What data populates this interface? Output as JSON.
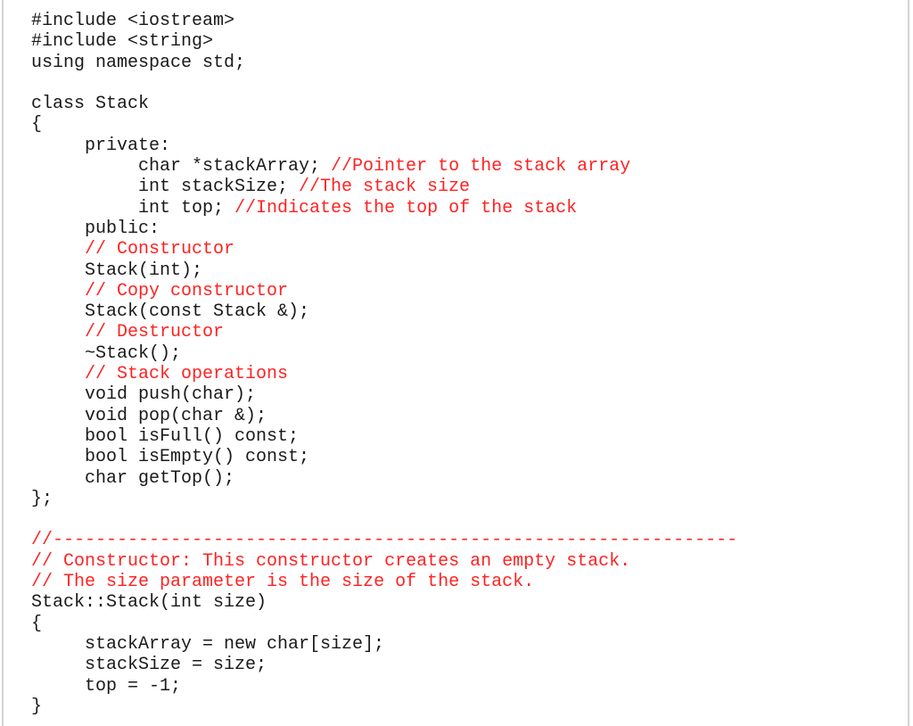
{
  "document": {
    "language": "C++",
    "colors": {
      "code_text": "#1a1a1a",
      "comment": "#ff2222",
      "border": "#d4d4d4",
      "background": "#ffffff"
    },
    "lines": [
      {
        "indent": 0,
        "code": "#include <iostream>",
        "comment": ""
      },
      {
        "indent": 0,
        "code": "#include <string>",
        "comment": ""
      },
      {
        "indent": 0,
        "code": "using namespace std;",
        "comment": ""
      },
      {
        "indent": 0,
        "code": "",
        "comment": ""
      },
      {
        "indent": 0,
        "code": "class Stack",
        "comment": ""
      },
      {
        "indent": 0,
        "code": "{",
        "comment": ""
      },
      {
        "indent": 1,
        "code": "private:",
        "comment": ""
      },
      {
        "indent": 2,
        "code": "char *stackArray; ",
        "comment": "//Pointer to the stack array"
      },
      {
        "indent": 2,
        "code": "int stackSize; ",
        "comment": "//The stack size"
      },
      {
        "indent": 2,
        "code": "int top; ",
        "comment": "//Indicates the top of the stack"
      },
      {
        "indent": 1,
        "code": "public:",
        "comment": ""
      },
      {
        "indent": 1,
        "code": "",
        "comment": "// Constructor"
      },
      {
        "indent": 1,
        "code": "Stack(int);",
        "comment": ""
      },
      {
        "indent": 1,
        "code": "",
        "comment": "// Copy constructor"
      },
      {
        "indent": 1,
        "code": "Stack(const Stack &);",
        "comment": ""
      },
      {
        "indent": 1,
        "code": "",
        "comment": "// Destructor"
      },
      {
        "indent": 1,
        "code": "~Stack();",
        "comment": ""
      },
      {
        "indent": 1,
        "code": "",
        "comment": "// Stack operations"
      },
      {
        "indent": 1,
        "code": "void push(char);",
        "comment": ""
      },
      {
        "indent": 1,
        "code": "void pop(char &);",
        "comment": ""
      },
      {
        "indent": 1,
        "code": "bool isFull() const;",
        "comment": ""
      },
      {
        "indent": 1,
        "code": "bool isEmpty() const;",
        "comment": ""
      },
      {
        "indent": 1,
        "code": "char getTop();",
        "comment": ""
      },
      {
        "indent": 0,
        "code": "};",
        "comment": ""
      },
      {
        "indent": 0,
        "code": "",
        "comment": ""
      },
      {
        "indent": 0,
        "code": "",
        "comment": "//----------------------------------------------------------------"
      },
      {
        "indent": 0,
        "code": "",
        "comment": "// Constructor: This constructor creates an empty stack."
      },
      {
        "indent": 0,
        "code": "",
        "comment": "// The size parameter is the size of the stack."
      },
      {
        "indent": 0,
        "code": "Stack::Stack(int size)",
        "comment": ""
      },
      {
        "indent": 0,
        "code": "{",
        "comment": ""
      },
      {
        "indent": 1,
        "code": "stackArray = new char[size];",
        "comment": ""
      },
      {
        "indent": 1,
        "code": "stackSize = size;",
        "comment": ""
      },
      {
        "indent": 1,
        "code": "top = -1;",
        "comment": ""
      },
      {
        "indent": 0,
        "code": "}",
        "comment": ""
      }
    ]
  }
}
